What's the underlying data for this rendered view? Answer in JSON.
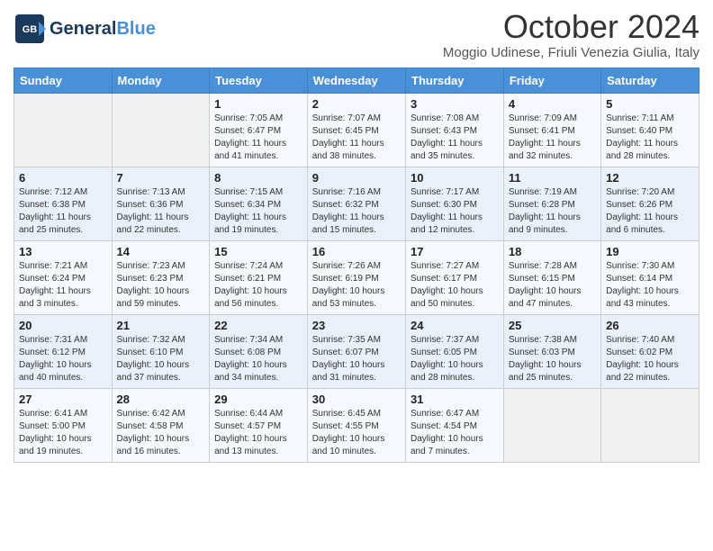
{
  "logo": {
    "text_general": "General",
    "text_blue": "Blue",
    "icon": "▶"
  },
  "title": "October 2024",
  "location": "Moggio Udinese, Friuli Venezia Giulia, Italy",
  "days_of_week": [
    "Sunday",
    "Monday",
    "Tuesday",
    "Wednesday",
    "Thursday",
    "Friday",
    "Saturday"
  ],
  "weeks": [
    [
      {
        "day": "",
        "sunrise": "",
        "sunset": "",
        "daylight": ""
      },
      {
        "day": "",
        "sunrise": "",
        "sunset": "",
        "daylight": ""
      },
      {
        "day": "1",
        "sunrise": "Sunrise: 7:05 AM",
        "sunset": "Sunset: 6:47 PM",
        "daylight": "Daylight: 11 hours and 41 minutes."
      },
      {
        "day": "2",
        "sunrise": "Sunrise: 7:07 AM",
        "sunset": "Sunset: 6:45 PM",
        "daylight": "Daylight: 11 hours and 38 minutes."
      },
      {
        "day": "3",
        "sunrise": "Sunrise: 7:08 AM",
        "sunset": "Sunset: 6:43 PM",
        "daylight": "Daylight: 11 hours and 35 minutes."
      },
      {
        "day": "4",
        "sunrise": "Sunrise: 7:09 AM",
        "sunset": "Sunset: 6:41 PM",
        "daylight": "Daylight: 11 hours and 32 minutes."
      },
      {
        "day": "5",
        "sunrise": "Sunrise: 7:11 AM",
        "sunset": "Sunset: 6:40 PM",
        "daylight": "Daylight: 11 hours and 28 minutes."
      }
    ],
    [
      {
        "day": "6",
        "sunrise": "Sunrise: 7:12 AM",
        "sunset": "Sunset: 6:38 PM",
        "daylight": "Daylight: 11 hours and 25 minutes."
      },
      {
        "day": "7",
        "sunrise": "Sunrise: 7:13 AM",
        "sunset": "Sunset: 6:36 PM",
        "daylight": "Daylight: 11 hours and 22 minutes."
      },
      {
        "day": "8",
        "sunrise": "Sunrise: 7:15 AM",
        "sunset": "Sunset: 6:34 PM",
        "daylight": "Daylight: 11 hours and 19 minutes."
      },
      {
        "day": "9",
        "sunrise": "Sunrise: 7:16 AM",
        "sunset": "Sunset: 6:32 PM",
        "daylight": "Daylight: 11 hours and 15 minutes."
      },
      {
        "day": "10",
        "sunrise": "Sunrise: 7:17 AM",
        "sunset": "Sunset: 6:30 PM",
        "daylight": "Daylight: 11 hours and 12 minutes."
      },
      {
        "day": "11",
        "sunrise": "Sunrise: 7:19 AM",
        "sunset": "Sunset: 6:28 PM",
        "daylight": "Daylight: 11 hours and 9 minutes."
      },
      {
        "day": "12",
        "sunrise": "Sunrise: 7:20 AM",
        "sunset": "Sunset: 6:26 PM",
        "daylight": "Daylight: 11 hours and 6 minutes."
      }
    ],
    [
      {
        "day": "13",
        "sunrise": "Sunrise: 7:21 AM",
        "sunset": "Sunset: 6:24 PM",
        "daylight": "Daylight: 11 hours and 3 minutes."
      },
      {
        "day": "14",
        "sunrise": "Sunrise: 7:23 AM",
        "sunset": "Sunset: 6:23 PM",
        "daylight": "Daylight: 10 hours and 59 minutes."
      },
      {
        "day": "15",
        "sunrise": "Sunrise: 7:24 AM",
        "sunset": "Sunset: 6:21 PM",
        "daylight": "Daylight: 10 hours and 56 minutes."
      },
      {
        "day": "16",
        "sunrise": "Sunrise: 7:26 AM",
        "sunset": "Sunset: 6:19 PM",
        "daylight": "Daylight: 10 hours and 53 minutes."
      },
      {
        "day": "17",
        "sunrise": "Sunrise: 7:27 AM",
        "sunset": "Sunset: 6:17 PM",
        "daylight": "Daylight: 10 hours and 50 minutes."
      },
      {
        "day": "18",
        "sunrise": "Sunrise: 7:28 AM",
        "sunset": "Sunset: 6:15 PM",
        "daylight": "Daylight: 10 hours and 47 minutes."
      },
      {
        "day": "19",
        "sunrise": "Sunrise: 7:30 AM",
        "sunset": "Sunset: 6:14 PM",
        "daylight": "Daylight: 10 hours and 43 minutes."
      }
    ],
    [
      {
        "day": "20",
        "sunrise": "Sunrise: 7:31 AM",
        "sunset": "Sunset: 6:12 PM",
        "daylight": "Daylight: 10 hours and 40 minutes."
      },
      {
        "day": "21",
        "sunrise": "Sunrise: 7:32 AM",
        "sunset": "Sunset: 6:10 PM",
        "daylight": "Daylight: 10 hours and 37 minutes."
      },
      {
        "day": "22",
        "sunrise": "Sunrise: 7:34 AM",
        "sunset": "Sunset: 6:08 PM",
        "daylight": "Daylight: 10 hours and 34 minutes."
      },
      {
        "day": "23",
        "sunrise": "Sunrise: 7:35 AM",
        "sunset": "Sunset: 6:07 PM",
        "daylight": "Daylight: 10 hours and 31 minutes."
      },
      {
        "day": "24",
        "sunrise": "Sunrise: 7:37 AM",
        "sunset": "Sunset: 6:05 PM",
        "daylight": "Daylight: 10 hours and 28 minutes."
      },
      {
        "day": "25",
        "sunrise": "Sunrise: 7:38 AM",
        "sunset": "Sunset: 6:03 PM",
        "daylight": "Daylight: 10 hours and 25 minutes."
      },
      {
        "day": "26",
        "sunrise": "Sunrise: 7:40 AM",
        "sunset": "Sunset: 6:02 PM",
        "daylight": "Daylight: 10 hours and 22 minutes."
      }
    ],
    [
      {
        "day": "27",
        "sunrise": "Sunrise: 6:41 AM",
        "sunset": "Sunset: 5:00 PM",
        "daylight": "Daylight: 10 hours and 19 minutes."
      },
      {
        "day": "28",
        "sunrise": "Sunrise: 6:42 AM",
        "sunset": "Sunset: 4:58 PM",
        "daylight": "Daylight: 10 hours and 16 minutes."
      },
      {
        "day": "29",
        "sunrise": "Sunrise: 6:44 AM",
        "sunset": "Sunset: 4:57 PM",
        "daylight": "Daylight: 10 hours and 13 minutes."
      },
      {
        "day": "30",
        "sunrise": "Sunrise: 6:45 AM",
        "sunset": "Sunset: 4:55 PM",
        "daylight": "Daylight: 10 hours and 10 minutes."
      },
      {
        "day": "31",
        "sunrise": "Sunrise: 6:47 AM",
        "sunset": "Sunset: 4:54 PM",
        "daylight": "Daylight: 10 hours and 7 minutes."
      },
      {
        "day": "",
        "sunrise": "",
        "sunset": "",
        "daylight": ""
      },
      {
        "day": "",
        "sunrise": "",
        "sunset": "",
        "daylight": ""
      }
    ]
  ]
}
